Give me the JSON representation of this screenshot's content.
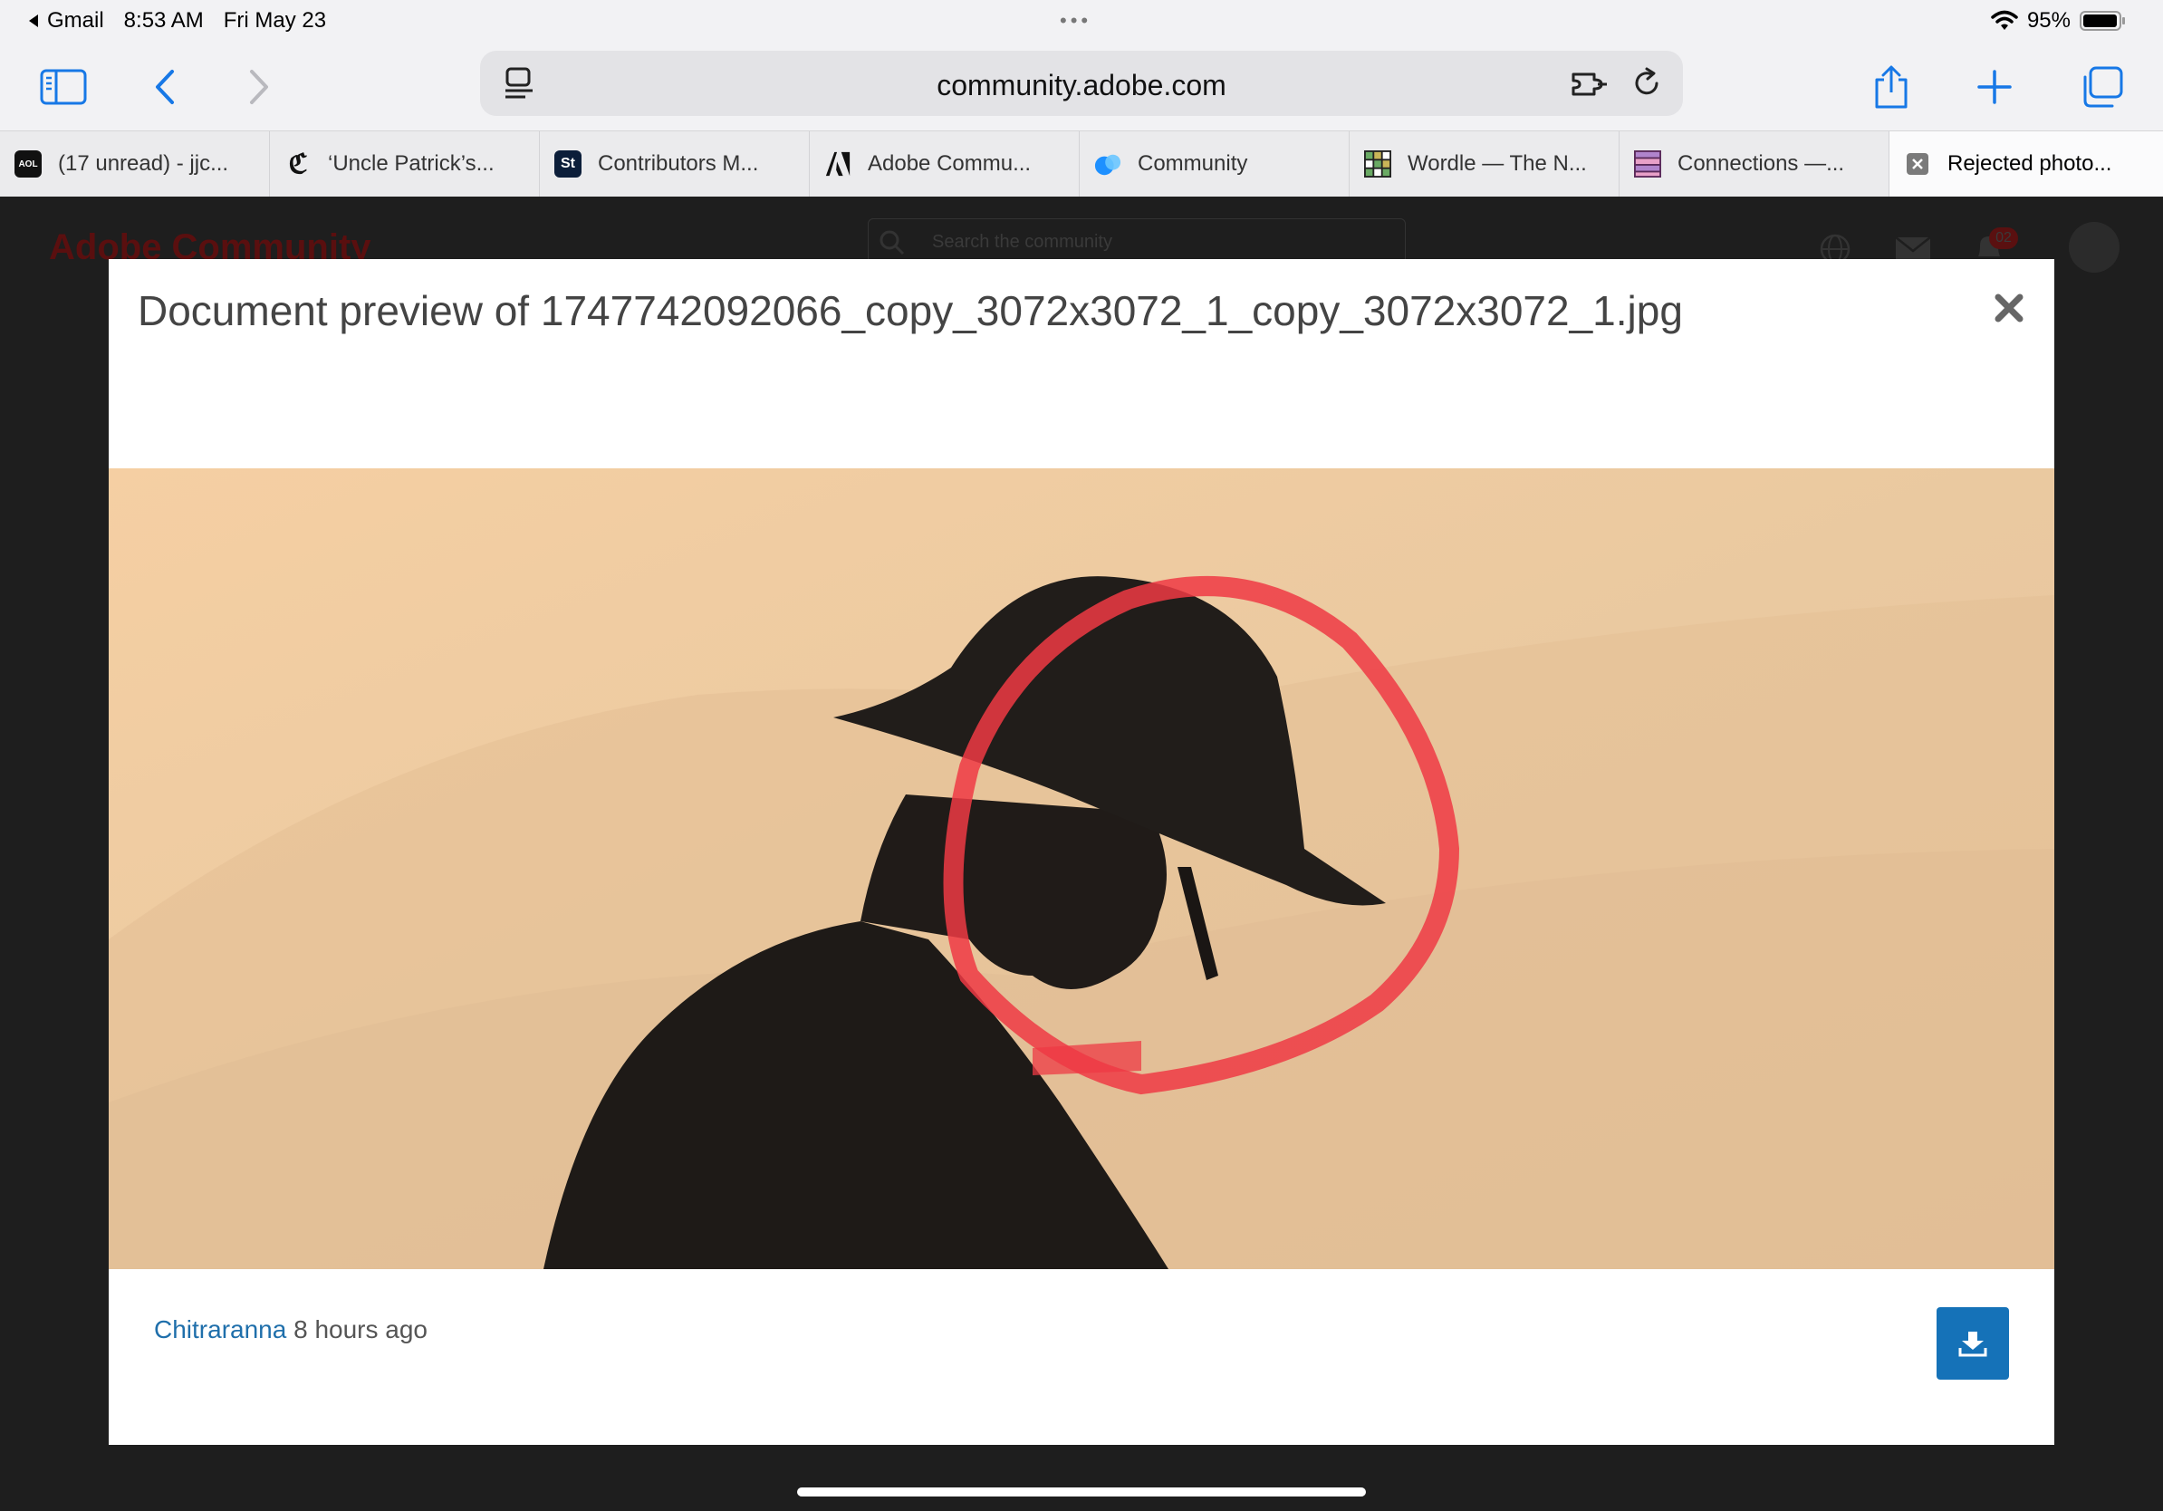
{
  "status_bar": {
    "back_app": "Gmail",
    "time": "8:53 AM",
    "date": "Fri May 23",
    "battery": "95%"
  },
  "toolbar": {
    "url": "community.adobe.com"
  },
  "tabs": [
    {
      "label": "(17 unread) - jjc...",
      "icon": "aol-icon"
    },
    {
      "label": "‘Uncle Patrick’s...",
      "icon": "nyt-icon"
    },
    {
      "label": "Contributors M...",
      "icon": "adobe-stock-icon"
    },
    {
      "label": "Adobe Commu...",
      "icon": "adobe-icon"
    },
    {
      "label": "Community",
      "icon": "community-icon"
    },
    {
      "label": "Wordle — The N...",
      "icon": "wordle-icon"
    },
    {
      "label": "Connections —...",
      "icon": "connections-icon"
    },
    {
      "label": "Rejected photo...",
      "icon": "close-icon"
    }
  ],
  "page": {
    "brand": "Adobe Community",
    "search_placeholder": "Search the community",
    "notification_count": "02"
  },
  "modal": {
    "title": "Document preview of 1747742092066_copy_3072x3072_1_copy_3072x3072_1.jpg",
    "author": "Chitraranna",
    "time_ago": "8 hours ago"
  },
  "colors": {
    "accent": "#1572b8",
    "link": "#1f6fab",
    "annotation": "#ee3a44"
  }
}
